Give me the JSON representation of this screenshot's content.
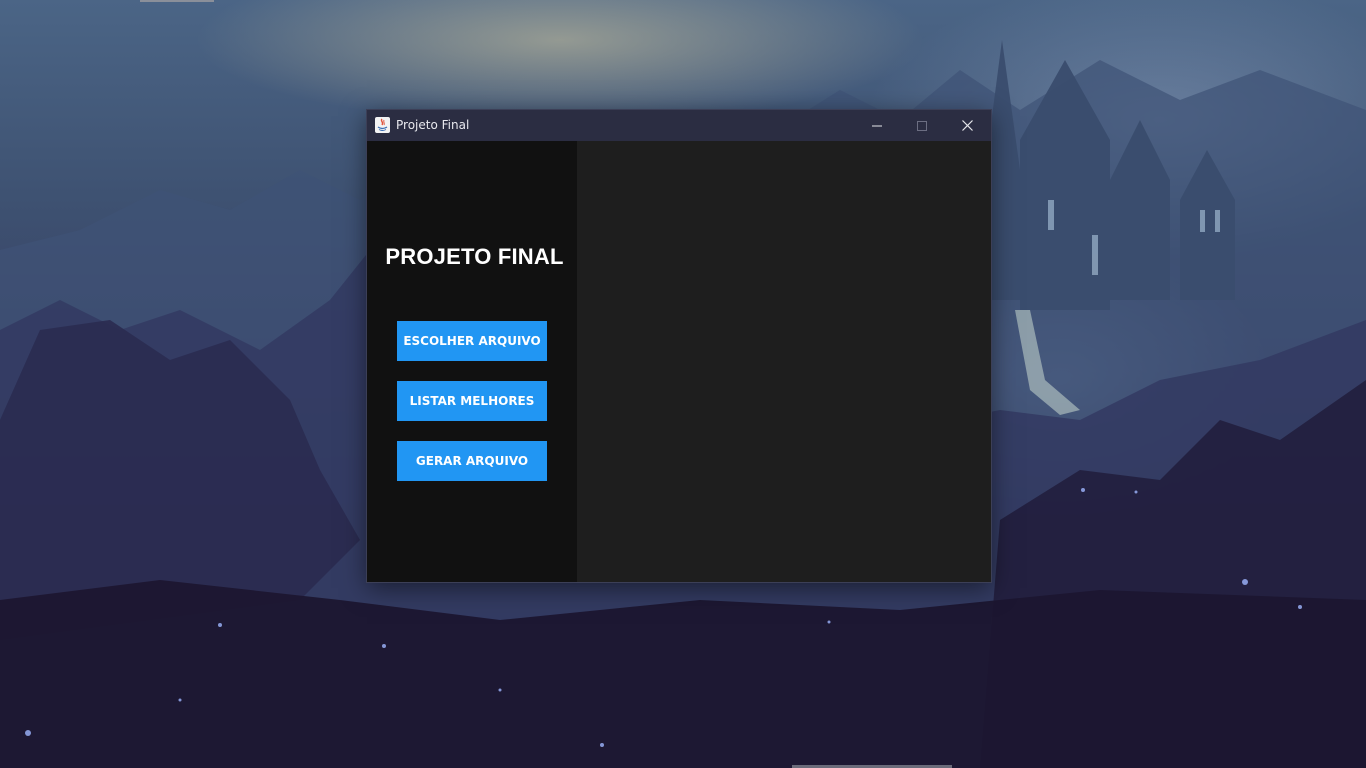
{
  "window": {
    "title": "Projeto Final",
    "controls": {
      "minimize_icon": "minimize-icon",
      "maximize_icon": "maximize-icon",
      "close_icon": "close-icon"
    }
  },
  "sidebar": {
    "title": "PROJETO FINAL",
    "buttons": [
      {
        "label": "ESCOLHER ARQUIVO"
      },
      {
        "label": "LISTAR MELHORES"
      },
      {
        "label": "GERAR ARQUIVO"
      }
    ]
  },
  "colors": {
    "accent": "#2196f3",
    "sidebar_bg": "#111111",
    "content_bg": "#1e1e1e",
    "titlebar_bg": "#2b2d42"
  }
}
